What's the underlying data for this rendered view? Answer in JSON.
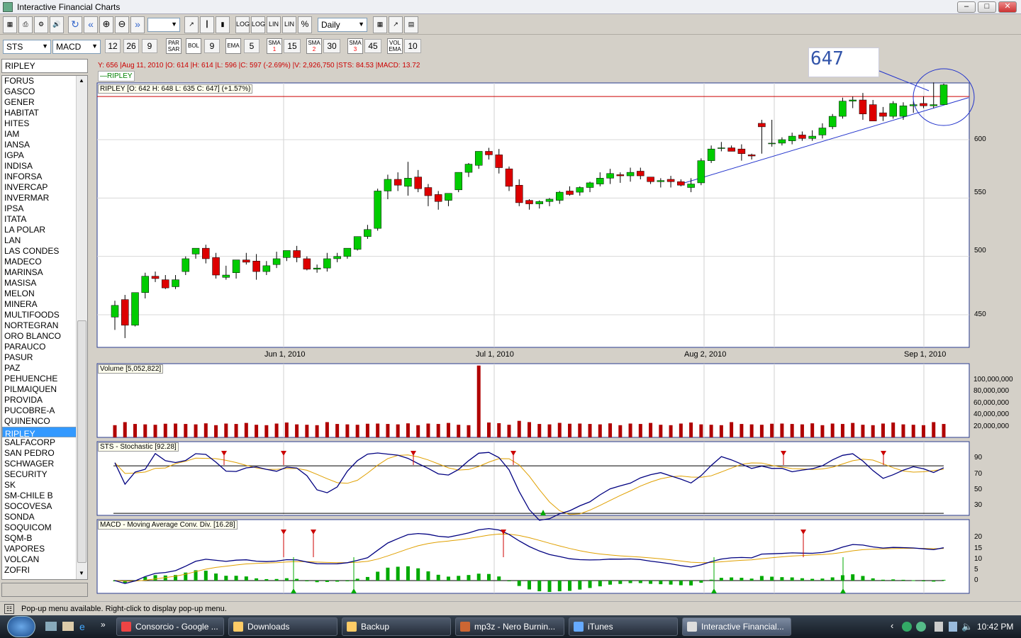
{
  "window": {
    "title": "Interactive Financial Charts"
  },
  "toolbar": {
    "interval": "Daily"
  },
  "indicators": {
    "study1": "STS",
    "study2": "MACD",
    "macd_fast": "12",
    "macd_slow": "26",
    "macd_signal": "9",
    "bol_label": "BOL",
    "bol_value": "9",
    "ema_label": "EMA",
    "ema_value": "5",
    "sma1_value": "15",
    "sma2_value": "30",
    "sma3_value": "45",
    "volema_value": "10"
  },
  "symbol_box": "RIPLEY",
  "symbol_list": [
    "FORUS",
    "GASCO",
    "GENER",
    "HABITAT",
    "HITES",
    "IAM",
    "IANSA",
    "IGPA",
    "INDISA",
    "INFORSA",
    "INVERCAP",
    "INVERMAR",
    "IPSA",
    "ITATA",
    "LA POLAR",
    "LAN",
    "LAS CONDES",
    "MADECO",
    "MARINSA",
    "MASISA",
    "MELON",
    "MINERA",
    "MULTIFOODS",
    "NORTEGRAN",
    "ORO BLANCO",
    "PARAUCO",
    "PASUR",
    "PAZ",
    "PEHUENCHE",
    "PILMAIQUEN",
    "PROVIDA",
    "PUCOBRE-A",
    "QUINENCO",
    "RIPLEY",
    "SALFACORP",
    "SAN PEDRO",
    "SCHWAGER",
    "SECURITY",
    "SK",
    "SM-CHILE B",
    "SOCOVESA",
    "SONDA",
    "SOQUICOM",
    "SQM-B",
    "VAPORES",
    "VOLCAN",
    "ZOFRI"
  ],
  "selected_symbol": "RIPLEY",
  "info_line": "Y: 656 |Aug 11, 2010 |O: 614 |H: 614 |L: 596 |C: 597 (-2.69%) |V: 2,926,750 |STS: 84.53 |MACD: 13.72",
  "legend": {
    "series": "RIPLEY"
  },
  "annotation": {
    "price_note": "647"
  },
  "price_panel": {
    "label": "RIPLEY [O: 642  H: 648  L: 635  C: 647] (+1.57%)",
    "y_ticks": [
      "600",
      "550",
      "500",
      "450"
    ],
    "x_ticks": [
      "Jun 1, 2010",
      "Jul 1, 2010",
      "Aug 2, 2010",
      "Sep 1, 2010"
    ]
  },
  "volume_panel": {
    "label": "Volume [5,052,822]",
    "y_ticks": [
      "100,000,000",
      "80,000,000",
      "60,000,000",
      "40,000,000",
      "20,000,000"
    ]
  },
  "sts_panel": {
    "label": "STS - Stochastic [92.28]",
    "y_ticks": [
      "90",
      "70",
      "50",
      "30"
    ]
  },
  "macd_panel": {
    "label": "MACD - Moving Average Conv. Div. [16.28]",
    "y_ticks": [
      "20",
      "15",
      "10",
      "5",
      "0"
    ]
  },
  "status": {
    "text": "Pop-up menu available. Right-click to display pop-up menu."
  },
  "taskbar": {
    "items": [
      "Consorcio - Google ...",
      "Downloads",
      "Backup",
      "mp3z - Nero Burnin...",
      "iTunes",
      "Interactive Financial..."
    ],
    "clock": "10:42 PM"
  },
  "colors": {
    "up": "#00cc00",
    "down": "#dd0000",
    "panel_border": "#2a3b8f",
    "trend": "#2233cc",
    "selected": "#3399ff"
  },
  "chart_data": {
    "type": "candlestick",
    "dates": [
      "2010-05-11",
      "2010-05-12",
      "2010-05-13",
      "2010-05-14",
      "2010-05-17",
      "2010-05-18",
      "2010-05-19",
      "2010-05-20",
      "2010-05-21",
      "2010-05-24",
      "2010-05-25",
      "2010-05-26",
      "2010-05-27",
      "2010-05-28",
      "2010-06-01",
      "2010-06-02",
      "2010-06-03",
      "2010-06-04",
      "2010-06-07",
      "2010-06-08",
      "2010-06-09",
      "2010-06-10",
      "2010-06-11",
      "2010-06-14",
      "2010-06-15",
      "2010-06-16",
      "2010-06-17",
      "2010-06-18",
      "2010-06-21",
      "2010-06-22",
      "2010-06-23",
      "2010-06-24",
      "2010-06-25",
      "2010-06-28",
      "2010-06-29",
      "2010-06-30",
      "2010-07-01",
      "2010-07-02",
      "2010-07-05",
      "2010-07-06",
      "2010-07-07",
      "2010-07-08",
      "2010-07-09",
      "2010-07-12",
      "2010-07-13",
      "2010-07-14",
      "2010-07-15",
      "2010-07-16",
      "2010-07-19",
      "2010-07-20",
      "2010-07-21",
      "2010-07-22",
      "2010-07-23",
      "2010-07-26",
      "2010-07-27",
      "2010-07-28",
      "2010-07-29",
      "2010-07-30",
      "2010-08-02",
      "2010-08-03",
      "2010-08-04",
      "2010-08-05",
      "2010-08-06",
      "2010-08-09",
      "2010-08-10",
      "2010-08-11",
      "2010-08-12",
      "2010-08-13",
      "2010-08-16",
      "2010-08-17",
      "2010-08-18",
      "2010-08-19",
      "2010-08-20",
      "2010-08-23",
      "2010-08-24",
      "2010-08-25",
      "2010-08-26",
      "2010-08-27",
      "2010-08-30",
      "2010-08-31",
      "2010-09-01",
      "2010-09-02",
      "2010-09-03"
    ],
    "open": [
      448,
      463,
      441,
      469,
      483,
      480,
      474,
      487,
      502,
      507,
      499,
      482,
      486,
      497,
      496,
      487,
      493,
      499,
      505,
      498,
      489,
      490,
      498,
      500,
      506,
      517,
      524,
      556,
      566,
      560,
      568,
      559,
      553,
      548,
      557,
      572,
      578,
      590,
      587,
      575,
      561,
      548,
      545,
      547,
      548,
      556,
      555,
      559,
      562,
      567,
      570,
      569,
      573,
      568,
      564,
      566,
      564,
      559,
      563,
      582,
      593,
      593,
      592,
      587,
      614,
      597,
      597,
      599,
      604,
      601,
      604,
      611,
      620,
      633,
      634,
      630,
      623,
      620,
      620,
      629,
      631,
      629,
      630
    ],
    "high": [
      462,
      467,
      468,
      486,
      487,
      484,
      484,
      500,
      506,
      510,
      503,
      492,
      491,
      503,
      502,
      496,
      504,
      503,
      509,
      500,
      493,
      503,
      503,
      506,
      517,
      527,
      558,
      570,
      572,
      581,
      574,
      562,
      556,
      549,
      572,
      580,
      590,
      593,
      592,
      577,
      566,
      549,
      548,
      550,
      556,
      560,
      560,
      564,
      572,
      575,
      572,
      576,
      576,
      568,
      567,
      569,
      566,
      567,
      584,
      595,
      598,
      595,
      596,
      588,
      617,
      617,
      602,
      606,
      607,
      608,
      614,
      622,
      636,
      637,
      640,
      634,
      628,
      633,
      632,
      633,
      637,
      649,
      648
    ],
    "low": [
      437,
      430,
      440,
      464,
      478,
      472,
      472,
      484,
      498,
      494,
      481,
      480,
      481,
      493,
      480,
      484,
      490,
      496,
      495,
      488,
      486,
      487,
      495,
      498,
      505,
      515,
      522,
      549,
      556,
      552,
      555,
      543,
      540,
      543,
      555,
      568,
      575,
      583,
      571,
      556,
      543,
      540,
      541,
      543,
      545,
      552,
      552,
      555,
      560,
      562,
      563,
      564,
      566,
      562,
      559,
      559,
      560,
      555,
      561,
      580,
      590,
      590,
      582,
      583,
      588,
      594,
      595,
      596,
      599,
      599,
      601,
      609,
      618,
      627,
      617,
      620,
      616,
      618,
      617,
      623,
      627,
      627,
      635
    ],
    "close": [
      458,
      441,
      469,
      483,
      481,
      473,
      480,
      498,
      507,
      498,
      484,
      484,
      497,
      495,
      487,
      492,
      498,
      505,
      499,
      489,
      490,
      498,
      500,
      507,
      517,
      523,
      556,
      566,
      561,
      567,
      558,
      552,
      547,
      554,
      572,
      579,
      590,
      587,
      576,
      560,
      546,
      545,
      547,
      549,
      555,
      553,
      559,
      563,
      567,
      571,
      569,
      572,
      569,
      564,
      565,
      564,
      561,
      562,
      582,
      592,
      593,
      590,
      588,
      586,
      611,
      597,
      600,
      603,
      601,
      603,
      610,
      620,
      633,
      634,
      622,
      616,
      620,
      631,
      629,
      630,
      629,
      630,
      647
    ]
  }
}
